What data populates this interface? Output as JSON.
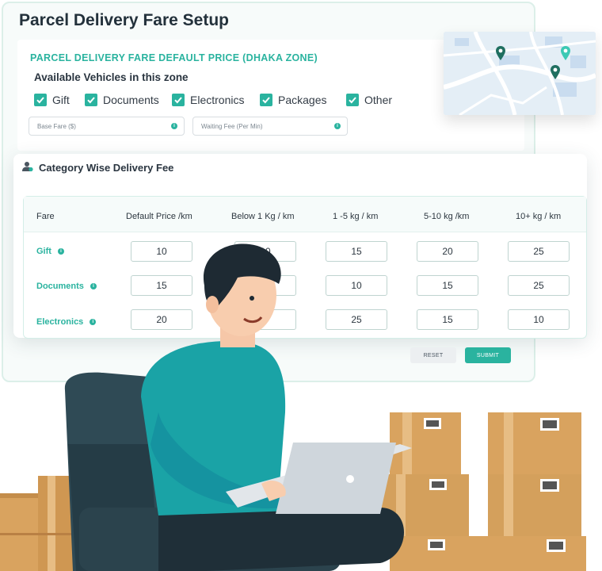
{
  "window": {
    "title": "Parcel Delivery Fare Setup"
  },
  "default_price": {
    "title": "PARCEL DELIVERY FARE DEFAULT PRICE (DHAKA ZONE)",
    "vehicles_title": "Available Vehicles in this zone",
    "vehicles": [
      {
        "label": "Gift",
        "checked": true
      },
      {
        "label": "Documents",
        "checked": true
      },
      {
        "label": "Electronics",
        "checked": true
      },
      {
        "label": "Packages",
        "checked": true
      },
      {
        "label": "Other",
        "checked": true
      }
    ],
    "base_fare_placeholder": "Base Fare ($)",
    "waiting_fee_placeholder": "Waiting Fee (Per Min)"
  },
  "category": {
    "title": "Category Wise Delivery Fee",
    "columns": [
      "Fare",
      "Default Price /km",
      "Below 1 Kg /  km",
      "1 -5 kg / km",
      "5-10 kg /km",
      "10+ kg / km"
    ],
    "rows": [
      {
        "label": "Gift",
        "values": [
          "10",
          "10",
          "15",
          "20",
          "25"
        ]
      },
      {
        "label": "Documents",
        "values": [
          "15",
          "",
          "10",
          "15",
          "25"
        ]
      },
      {
        "label": "Electronics",
        "values": [
          "20",
          "",
          "25",
          "15",
          "10"
        ]
      }
    ]
  },
  "actions": {
    "reset": "RESET",
    "submit": "SUBMIT"
  },
  "colors": {
    "accent": "#2ab39f",
    "title": "#23313b",
    "shirt": "#1aa3a6",
    "box": "#d9a35f"
  },
  "icons": [
    "check-icon",
    "info-icon",
    "user-icon",
    "map-pin-icon"
  ]
}
